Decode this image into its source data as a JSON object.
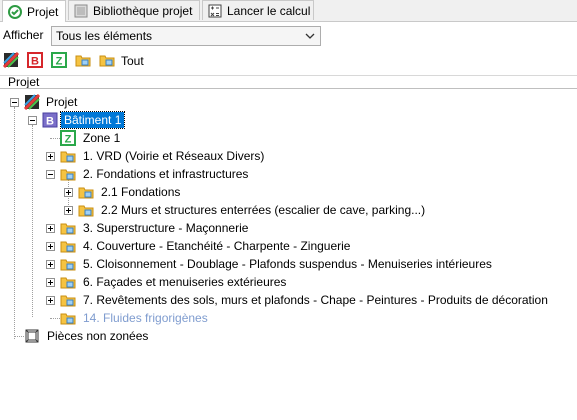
{
  "tabs": [
    {
      "label": "Projet",
      "active": true,
      "icon": "house-check-icon"
    },
    {
      "label": "Bibliothèque projet",
      "active": false,
      "icon": "library-icon"
    },
    {
      "label": "Lancer le calcul",
      "active": false,
      "icon": "calculator-icon"
    }
  ],
  "filter": {
    "label": "Afficher",
    "selected": "Tous les éléments"
  },
  "toolbar": {
    "tout_label": "Tout",
    "icons": [
      "project-icon",
      "building-b-icon",
      "zone-z-icon",
      "folder-icon",
      "folder-icon"
    ]
  },
  "section_title": "Projet",
  "tree": {
    "root": "Projet",
    "building": "Bâtiment 1",
    "zone": "Zone 1",
    "lots": [
      "1. VRD (Voirie et Réseaux Divers)",
      "2. Fondations et infrastructures",
      "2.1 Fondations",
      "2.2 Murs et structures enterrées (escalier de cave, parking...)",
      "3. Superstructure - Maçonnerie",
      "4. Couverture - Etanchéité - Charpente - Zinguerie",
      "5. Cloisonnement - Doublage - Plafonds suspendus - Menuiseries intérieures",
      "6. Façades et menuiseries extérieures",
      "7. Revêtements des sols, murs et plafonds - Chape - Peintures - Produits de décoration",
      "14. Fluides frigorigènes"
    ],
    "unzoned": "Pièces non zonées"
  },
  "colors": {
    "selection": "#0078d7",
    "disabled_text": "#7f9ccf",
    "folder": "#f5c342",
    "building_b": "#7b6fc9",
    "zone_green": "#2aa84a",
    "toolbar_red": "#d6262b"
  }
}
